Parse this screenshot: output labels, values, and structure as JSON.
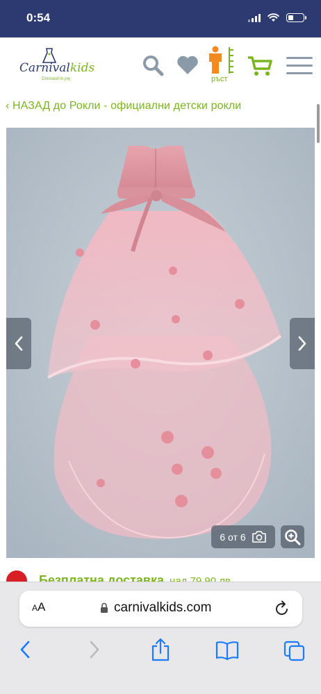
{
  "status_bar": {
    "time": "0:54",
    "battery_level": 0.35
  },
  "header": {
    "logo": {
      "name_part1": "Carnival",
      "name_part2": "kids",
      "tagline": "Dressed in joy"
    },
    "icons": [
      "search-icon",
      "heart-icon",
      "height-icon",
      "cart-icon",
      "menu-icon"
    ],
    "size_label": "ръст",
    "brand_colors": {
      "navy": "#2d3a72",
      "green": "#7ab51d"
    }
  },
  "back_link": "‹ НАЗАД до Рокли - официални детски рокли",
  "gallery": {
    "counter_text": "6 от 6",
    "prev_icon": "chevron-left-icon",
    "next_icon": "chevron-right-icon"
  },
  "delivery": {
    "text": "Безплатна доставка",
    "extra": "над 79.90 лв."
  },
  "browser": {
    "aa_label_small": "A",
    "aa_label_large": "A",
    "url": "carnivalkids.com"
  }
}
